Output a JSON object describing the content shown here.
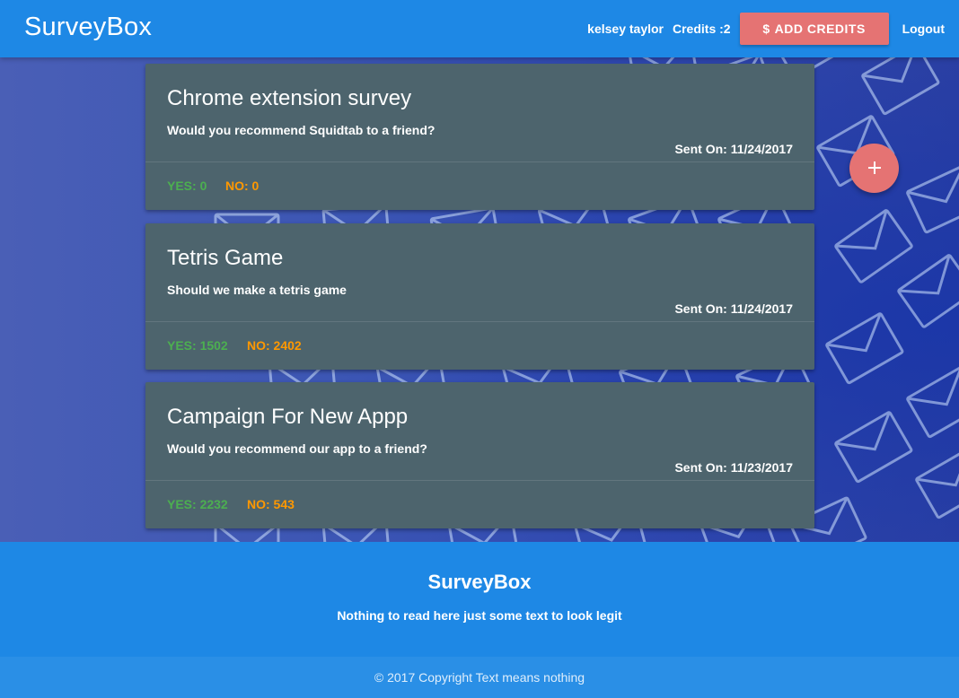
{
  "navbar": {
    "brand": "SurveyBox",
    "user_name": "kelsey taylor",
    "credits_label": "Credits :2",
    "add_credits_icon": "$",
    "add_credits_label": "ADD CREDITS",
    "logout_label": "Logout"
  },
  "surveys": [
    {
      "title": "Chrome extension survey",
      "question": "Would you recommend Squidtab to a friend?",
      "sent_on": "Sent On: 11/24/2017",
      "yes": "YES: 0",
      "no": "NO: 0"
    },
    {
      "title": "Tetris Game",
      "question": "Should we make a tetris game",
      "sent_on": "Sent On: 11/24/2017",
      "yes": "YES: 1502",
      "no": "NO: 2402"
    },
    {
      "title": "Campaign For New Appp",
      "question": "Would you recommend our app to a friend?",
      "sent_on": "Sent On: 11/23/2017",
      "yes": "YES: 2232",
      "no": "NO: 543"
    }
  ],
  "fab": {
    "icon": "plus-icon"
  },
  "footer": {
    "title": "SurveyBox",
    "text": "Nothing to read here just some text to look legit",
    "copyright": "© 2017 Copyright Text means nothing"
  },
  "colors": {
    "primary": "#1e88e5",
    "accent": "#e57373",
    "card": "#4d646d",
    "yes": "#4caf50",
    "no": "#ff9800"
  }
}
